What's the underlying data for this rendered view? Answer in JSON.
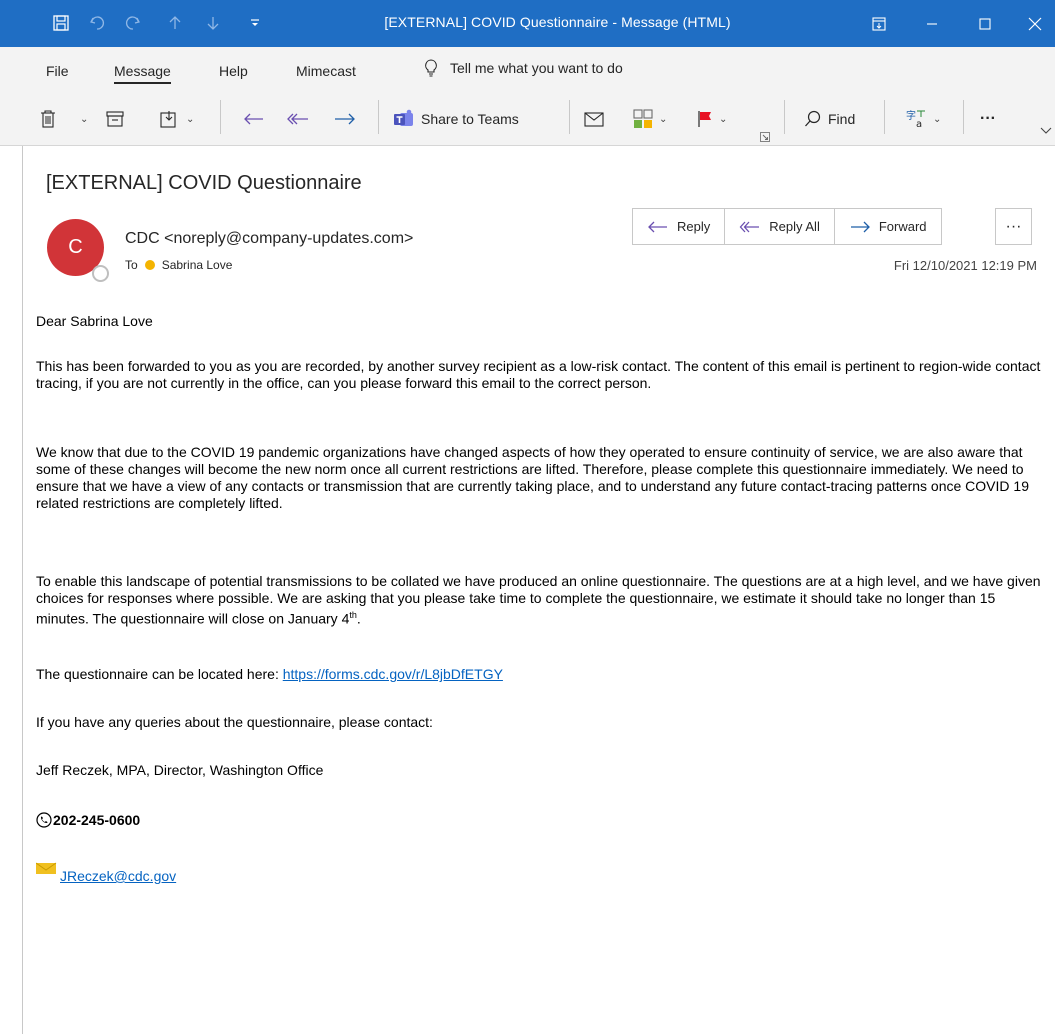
{
  "window": {
    "title": "[EXTERNAL] COVID Questionnaire  -  Message (HTML)"
  },
  "menu": {
    "items": [
      "File",
      "Message",
      "Help",
      "Mimecast"
    ],
    "tell_me": "Tell me what you want to do"
  },
  "ribbon": {
    "share_to_teams": "Share to Teams",
    "find": "Find",
    "more": "···"
  },
  "message": {
    "subject": "[EXTERNAL] COVID Questionnaire",
    "avatar_initial": "C",
    "from": "CDC <noreply@company-updates.com>",
    "to_label": "To",
    "to_name": "Sabrina Love",
    "date": "Fri 12/10/2021 12:19 PM",
    "actions": {
      "reply": "Reply",
      "reply_all": "Reply All",
      "forward": "Forward",
      "more": "···"
    }
  },
  "body": {
    "greeting": "Dear Sabrina Love",
    "p1": "This has been forwarded to you as you are recorded, by another survey recipient as a low-risk contact. The content of this email is pertinent to region-wide contact tracing, if you are not currently in the office, can you please forward this email to the correct person.",
    "p2": "We know that due to the COVID 19 pandemic organizations have changed aspects of how they operated to ensure continuity of service, we are also aware that some of these changes will become the new norm once all current restrictions are lifted. Therefore, please complete this questionnaire immediately. We need to ensure that we have a view of any contacts or transmission that are currently taking place, and to understand any future contact-tracing patterns once COVID 19 related restrictions are completely lifted.",
    "p3": "To enable this landscape of potential transmissions to be collated we have produced an online questionnaire. The questions are at a high level, and we have given choices for responses where possible. We are asking that you please take time to complete the questionnaire, we estimate it should take no longer than 15 minutes. The questionnaire will close on January 4",
    "p3_sup": "th",
    "p3_end": ".",
    "p4_prefix": "The questionnaire can be located here: ",
    "p4_link": "https://forms.cdc.gov/r/L8jbDfETGY",
    "p5": "If you have any queries about the questionnaire, please contact:",
    "p6": "Jeff Reczek, MPA, Director, Washington Office",
    "phone": "202-245-0600",
    "email": "JReczek@cdc.gov"
  },
  "colors": {
    "titlebar": "#1f6ec4",
    "avatar": "#d13438",
    "link": "#0563c1",
    "flag": "#e81123"
  }
}
